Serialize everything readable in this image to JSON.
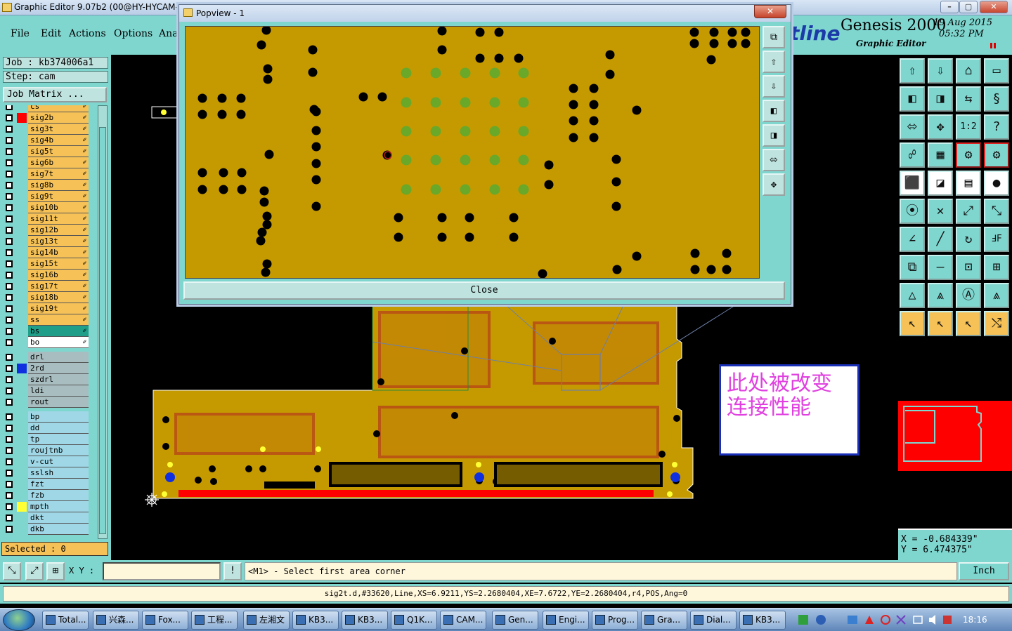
{
  "window": {
    "title": "Graphic Editor 9.07b2 (00@HY-HYCAM-",
    "controls": [
      "–",
      "▢",
      "✕"
    ]
  },
  "menu": [
    {
      "label": "File"
    },
    {
      "label": "Edit"
    },
    {
      "label": "Actions"
    },
    {
      "label": "Options"
    },
    {
      "label": "Ana"
    }
  ],
  "brand": {
    "logo": "tline",
    "product": "Genesis 2000",
    "subtitle": "Graphic Editor",
    "date": "19 Aug 2015",
    "time": "05:32 PM"
  },
  "left_panel": {
    "job": "Job : kb374006a1",
    "step": "Step: cam",
    "job_matrix": "Job Matrix ...",
    "selected": "Selected : 0",
    "layers_signal": [
      "cs",
      "sig2b",
      "sig3t",
      "sig4b",
      "sig5t",
      "sig6b",
      "sig7t",
      "sig8b",
      "sig9t",
      "sig10b",
      "sig11t",
      "sig12b",
      "sig13t",
      "sig14b",
      "sig15t",
      "sig16b",
      "sig17t",
      "sig18b",
      "sig19t",
      "ss",
      "bs",
      "bo"
    ],
    "layers_drill": [
      "drl",
      "2rd",
      "szdrl",
      "ldi",
      "rout"
    ],
    "layers_misc": [
      "bp",
      "dd",
      "tp",
      "roujtnb",
      "v-cut",
      "sslsh",
      "fzt",
      "fzb",
      "mpth",
      "dkt",
      "dkb"
    ]
  },
  "popview": {
    "title": "Popview - 1",
    "close_x": "✕",
    "close_button": "Close"
  },
  "annotation": {
    "line1": "此处被改变",
    "line2": "连接性能"
  },
  "coords": {
    "x": "X = -0.684339\"",
    "y": "Y = 6.474375\""
  },
  "status": {
    "xy_label": "X Y :",
    "xy_value": "",
    "excl": "!",
    "prompt": "<M1> - Select first area corner",
    "unit": "Inch",
    "info": "sig2t.d,#33620,Line,XS=6.9211,YS=2.2680404,XE=7.6722,YE=2.2680404,r4,POS,Ang=0"
  },
  "taskbar": {
    "tasks": [
      "Total...",
      "兴森...",
      "Fox...",
      "工程...",
      "左湘文",
      "KB3...",
      "KB3...",
      "Q1K...",
      "CAM...",
      "Gen...",
      "Engi...",
      "Prog...",
      "Gra...",
      "Dial...",
      "KB3..."
    ],
    "clock": "18:16"
  },
  "colors": {
    "panel": "#7fd6cf",
    "copper": "#c59a00",
    "signal_layer": "#f6c258",
    "selected_layer": "#1f9e89",
    "drill_hole": "#000000",
    "via_green": "#6aa829",
    "annotation_text": "#e040e0",
    "annotation_border": "#1a2fb8"
  }
}
